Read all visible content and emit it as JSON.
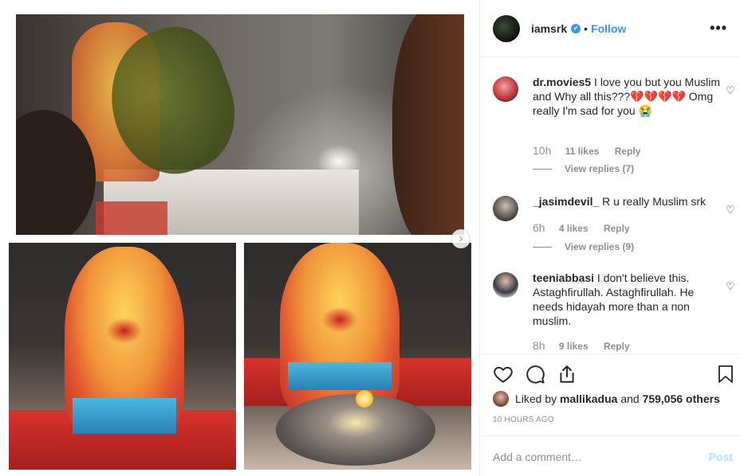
{
  "header": {
    "username": "iamsrk",
    "verified_icon": "verified-badge-icon",
    "separator": "•",
    "follow_label": "Follow",
    "more_label": "•••"
  },
  "gallery": {
    "next_label": "›",
    "accent": "#3897f0"
  },
  "comments": [
    {
      "username": "dr.movies5",
      "text": "I love you but you Muslim and Why all this???💔💔💔💔 Omg really I'm sad for you 😭",
      "time": "10h",
      "likes": "11 likes",
      "reply": "Reply",
      "view_replies": "View replies (7)"
    },
    {
      "username": "_jasimdevil_",
      "text": "R u really Muslim srk",
      "time": "6h",
      "likes": "4 likes",
      "reply": "Reply",
      "view_replies": "View replies (9)"
    },
    {
      "username": "teeniabbasi",
      "text": "I don't believe this. Astaghfirullah. Astaghfirullah. He needs hidayah more than a non muslim.",
      "time": "8h",
      "likes": "9 likes",
      "reply": "Reply"
    }
  ],
  "actions": {
    "like_icon": "heart-icon",
    "comment_icon": "comment-icon",
    "share_icon": "share-icon",
    "save_icon": "bookmark-icon"
  },
  "likes": {
    "prefix": "Liked by",
    "user": "mallikadua",
    "conjunction": "and",
    "count": "759,056 others"
  },
  "timestamp": "10 HOURS AGO",
  "add_comment": {
    "placeholder": "Add a comment…",
    "post_label": "Post"
  }
}
